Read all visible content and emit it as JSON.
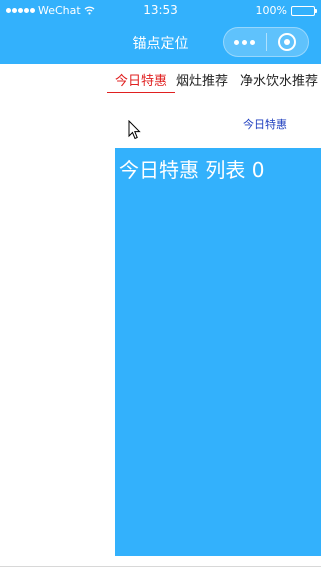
{
  "status_bar": {
    "carrier": "WeChat",
    "time": "13:53",
    "battery": "100%",
    "icons": [
      "signal-dots-icon",
      "wifi-icon",
      "battery-icon"
    ]
  },
  "nav_bar": {
    "title": "锚点定位",
    "capsule_icons": [
      "more-dots-icon",
      "close-circle-icon"
    ],
    "background_color": "#33b1fc"
  },
  "tabs": [
    {
      "label": "今日特惠",
      "active": true
    },
    {
      "label": "烟灶推荐",
      "active": false
    },
    {
      "label": "净水饮水推荐",
      "active": false
    }
  ],
  "anchor_link": "今日特惠",
  "panel": {
    "title": "今日特惠 列表 0",
    "color": "#33b1fc"
  },
  "colors": {
    "accent": "#33b1fc",
    "active_tab": "#e02020",
    "link": "#1f3fbf"
  }
}
